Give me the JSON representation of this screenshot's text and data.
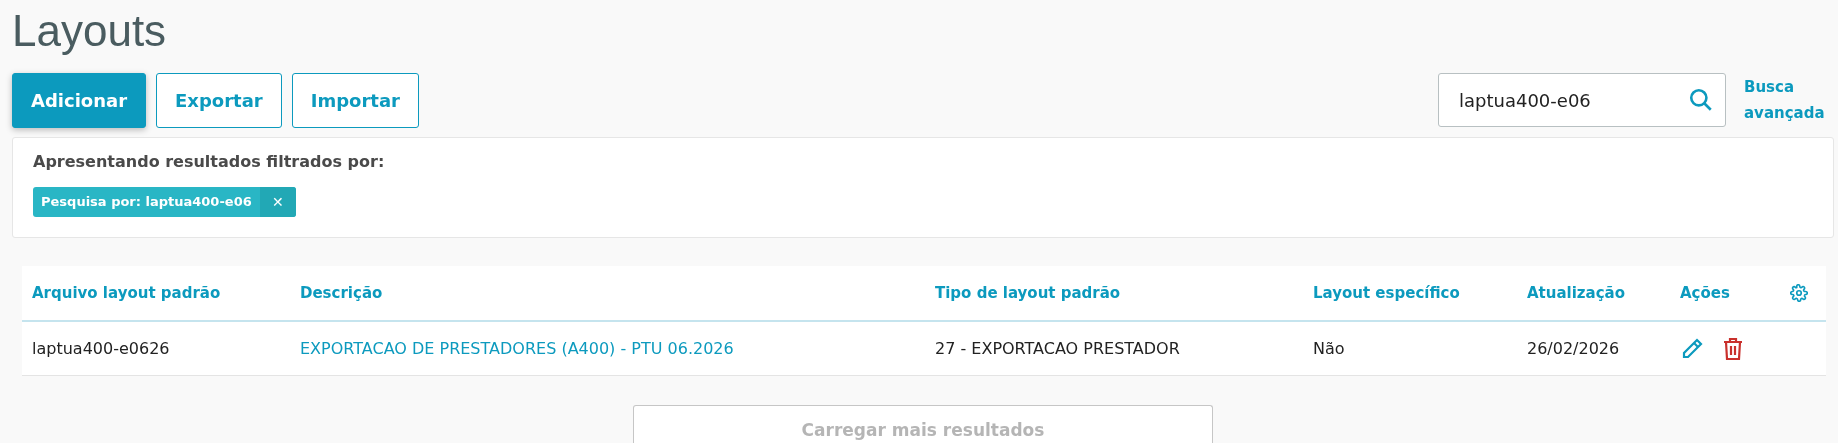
{
  "title": "Layouts",
  "actions": [
    {
      "label": "Adicionar",
      "kind": "primary"
    },
    {
      "label": "Exportar",
      "kind": "secondary"
    },
    {
      "label": "Importar",
      "kind": "secondary"
    }
  ],
  "search": {
    "value": "laptua400-e06",
    "advanced_link": "Busca avançada"
  },
  "filter_panel": {
    "heading": "Apresentando resultados filtrados por:",
    "chips": [
      {
        "label": "Pesquisa por: laptua400-e06",
        "remove": "✕"
      }
    ]
  },
  "table": {
    "columns": [
      "Arquivo layout padrão",
      "Descrição",
      "Tipo de layout padrão",
      "Layout específico",
      "Atualização",
      "Ações"
    ],
    "rows": [
      {
        "file": "laptua400-e0626",
        "description": "EXPORTACAO DE PRESTADORES (A400) - PTU 06.2026",
        "type": "27 - EXPORTACAO PRESTADOR",
        "specific": "Não",
        "updated": "26/02/2026"
      }
    ]
  },
  "load_more": {
    "label": "Carregar mais resultados",
    "disabled": true
  }
}
